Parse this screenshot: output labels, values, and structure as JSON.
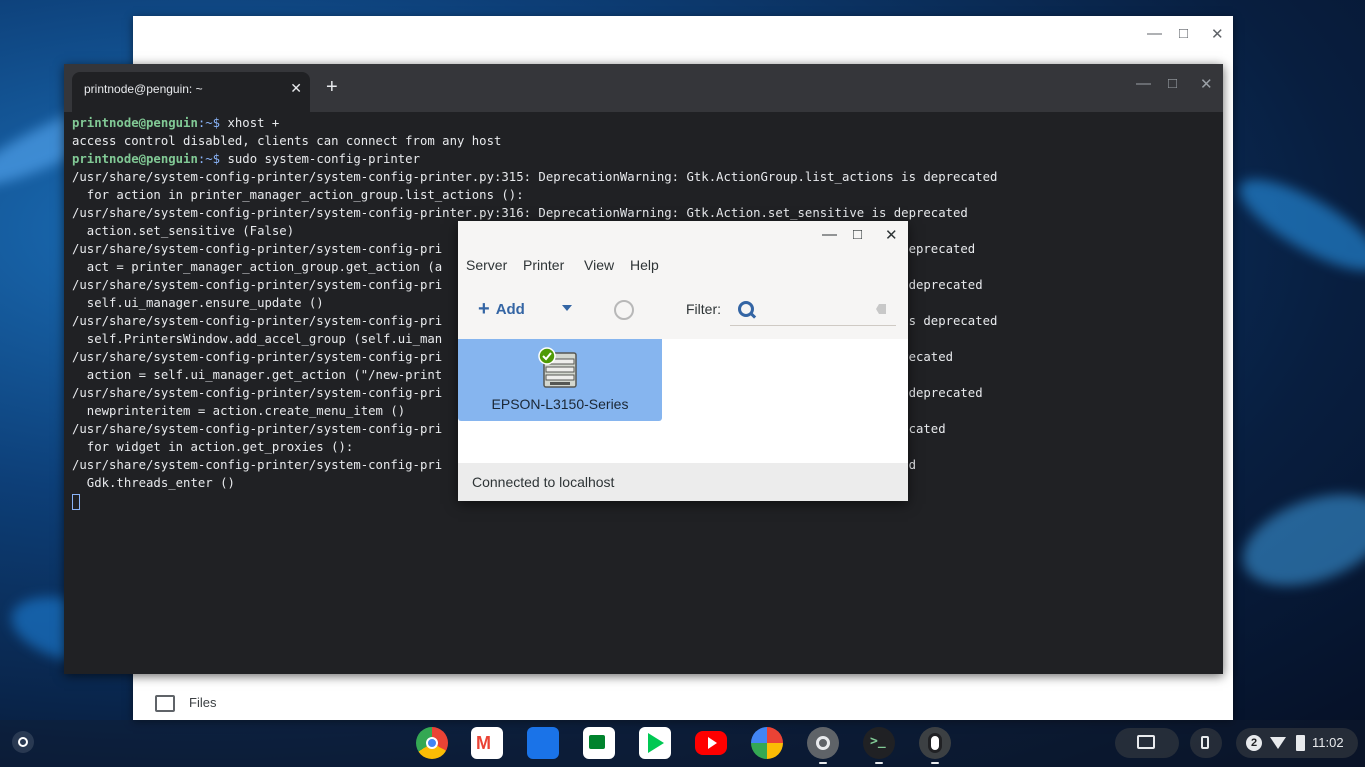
{
  "terminal": {
    "tab_title": "printnode@penguin: ~",
    "lines": [
      {
        "user": "printnode@penguin",
        "path": ":~$",
        "text": " xhost +"
      },
      {
        "text": "access control disabled, clients can connect from any host"
      },
      {
        "user": "printnode@penguin",
        "path": ":~$",
        "text": " sudo system-config-printer"
      },
      {
        "text": "/usr/share/system-config-printer/system-config-printer.py:315: DeprecationWarning: Gtk.ActionGroup.list_actions is deprecated"
      },
      {
        "text": "  for action in printer_manager_action_group.list_actions ():"
      },
      {
        "text": "/usr/share/system-config-printer/system-config-printer.py:316: DeprecationWarning: Gtk.Action.set_sensitive is deprecated"
      },
      {
        "text": "  action.set_sensitive (False)"
      },
      {
        "text": "/usr/share/system-config-printer/system-config-pri                                                        on is deprecated"
      },
      {
        "text": "  act = printer_manager_action_group.get_action (a"
      },
      {
        "text": "/usr/share/system-config-printer/system-config-pri                                                        ate is deprecated"
      },
      {
        "text": "  self.ui_manager.ensure_update ()"
      },
      {
        "text": "/usr/share/system-config-printer/system-config-pri                                                        group is deprecated"
      },
      {
        "text": "  self.PrintersWindow.add_accel_group (self.ui_man"
      },
      {
        "text": "/usr/share/system-config-printer/system-config-pri                                                        is deprecated"
      },
      {
        "text": "  action = self.ui_manager.get_action (\"/new-print"
      },
      {
        "text": "/usr/share/system-config-printer/system-config-pri                                                        tem is deprecated"
      },
      {
        "text": "  newprinteritem = action.create_menu_item ()"
      },
      {
        "text": "/usr/share/system-config-printer/system-config-pri                                                        s deprecated"
      },
      {
        "text": "  for widget in action.get_proxies ():"
      },
      {
        "text": "/usr/share/system-config-printer/system-config-pri                                                        precated"
      },
      {
        "text": "  Gdk.threads_enter ()"
      }
    ]
  },
  "printer_window": {
    "menu": {
      "server": "Server",
      "printer": "Printer",
      "view": "View",
      "help": "Help"
    },
    "toolbar": {
      "add_label": "Add",
      "plus": "+",
      "filter_label": "Filter:"
    },
    "printer_name": "EPSON-L3150-Series",
    "status": "Connected to localhost"
  },
  "files": {
    "label": "Files"
  },
  "tray": {
    "notification_count": "2",
    "time": "11:02"
  },
  "shelf_apps": [
    "chrome-icon",
    "gmail-icon",
    "files-app-icon",
    "meet-icon",
    "play-store-icon",
    "youtube-icon",
    "photos-icon",
    "settings-icon",
    "terminal-icon",
    "linux-penguin-icon"
  ],
  "colors": {
    "terminal_bg": "#202124",
    "selection": "#86b5ef",
    "accent": "#3465a4",
    "prompt_user": "#81c995"
  }
}
